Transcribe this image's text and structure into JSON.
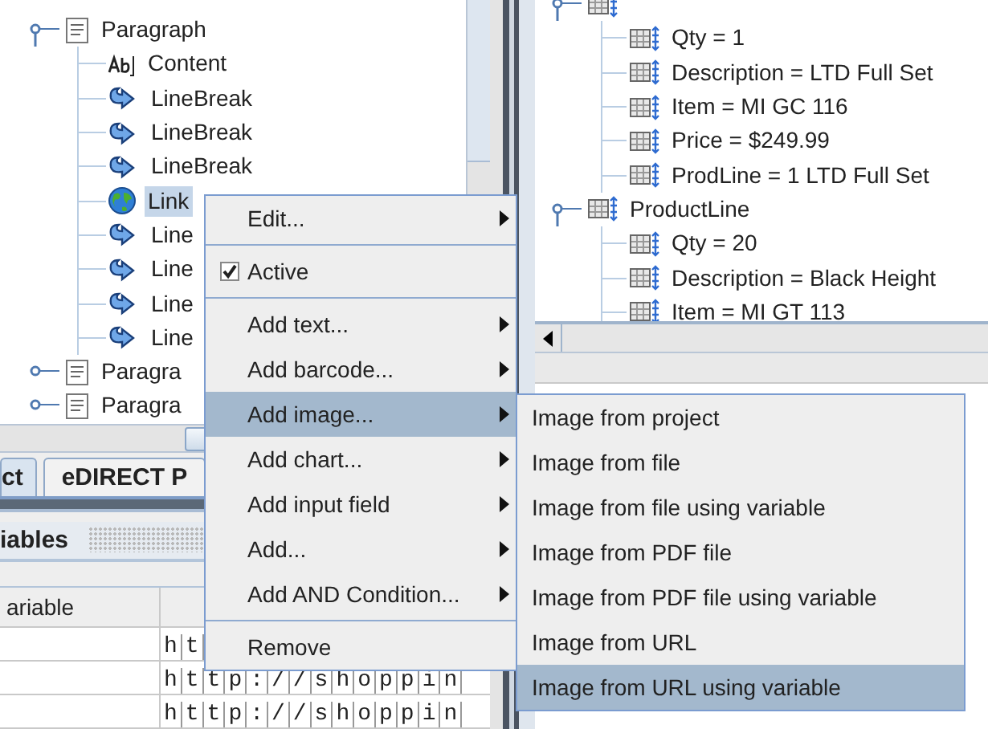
{
  "left_tree": {
    "items": [
      {
        "label": "Paragraph",
        "kind": "paragraph",
        "expanded": true,
        "selected": false,
        "children": [
          {
            "label": "Content",
            "kind": "text",
            "selected": false
          },
          {
            "label": "LineBreak",
            "kind": "linebreak",
            "selected": false
          },
          {
            "label": "LineBreak",
            "kind": "linebreak",
            "selected": false
          },
          {
            "label": "LineBreak",
            "kind": "linebreak",
            "selected": false
          },
          {
            "label": "Link",
            "kind": "link",
            "selected": true
          },
          {
            "label": "Line",
            "kind": "linebreak",
            "selected": false
          },
          {
            "label": "Line",
            "kind": "linebreak",
            "selected": false
          },
          {
            "label": "Line",
            "kind": "linebreak",
            "selected": false
          },
          {
            "label": "Line",
            "kind": "linebreak",
            "selected": false
          }
        ]
      },
      {
        "label": "Paragra",
        "kind": "paragraph",
        "expanded": false,
        "selected": false
      },
      {
        "label": "Paragra",
        "kind": "paragraph",
        "expanded": false,
        "selected": false
      }
    ]
  },
  "tabs": [
    {
      "label": "ct",
      "selected": true
    },
    {
      "label": "eDIRECT P",
      "selected": false
    }
  ],
  "variables_panel": {
    "title": "iables",
    "table": {
      "columns": [
        "ariable"
      ],
      "rows": [
        {
          "column_1": "",
          "column_2": "ht"
        },
        {
          "column_1": "",
          "column_2": "http://shoppin"
        },
        {
          "column_1": "",
          "column_2": "http://shoppin"
        }
      ]
    }
  },
  "right_tree": {
    "items": [
      {
        "expanded": true,
        "children": [
          {
            "label": "Qty = 1"
          },
          {
            "label": "Description = LTD Full Set"
          },
          {
            "label": "Item = MI GC 116"
          },
          {
            "label": "Price = $249.99"
          },
          {
            "label": "ProdLine = 1 LTD Full Set"
          }
        ]
      },
      {
        "label": "ProductLine",
        "expanded": true,
        "children": [
          {
            "label": "Qty = 20"
          },
          {
            "label": "Description = Black Height"
          },
          {
            "label": "Item = MI GT 113"
          }
        ]
      }
    ]
  },
  "context_menu": {
    "items": [
      {
        "kind": "item",
        "label": "Edit...",
        "submenu": true,
        "selected": false
      },
      {
        "kind": "separator"
      },
      {
        "kind": "check",
        "label": "Active",
        "checked": true,
        "selected": false
      },
      {
        "kind": "separator"
      },
      {
        "kind": "item",
        "label": "Add text...",
        "submenu": true,
        "selected": false
      },
      {
        "kind": "item",
        "label": "Add barcode...",
        "submenu": true,
        "selected": false
      },
      {
        "kind": "item",
        "label": "Add image...",
        "submenu": true,
        "selected": true
      },
      {
        "kind": "item",
        "label": "Add chart...",
        "submenu": true,
        "selected": false
      },
      {
        "kind": "item",
        "label": "Add input field",
        "submenu": true,
        "selected": false
      },
      {
        "kind": "item",
        "label": "Add...",
        "submenu": true,
        "selected": false
      },
      {
        "kind": "item",
        "label": "Add AND Condition...",
        "submenu": true,
        "selected": false
      },
      {
        "kind": "separator"
      },
      {
        "kind": "item",
        "label": "Remove",
        "submenu": false,
        "selected": false
      }
    ]
  },
  "submenu": {
    "items": [
      {
        "label": "Image from project",
        "selected": false
      },
      {
        "label": "Image from file",
        "selected": false
      },
      {
        "label": "Image from file using variable",
        "selected": false
      },
      {
        "label": "Image from PDF file",
        "selected": false
      },
      {
        "label": "Image from PDF file using variable",
        "selected": false
      },
      {
        "label": "Image from URL",
        "selected": false
      },
      {
        "label": "Image from URL using variable",
        "selected": true
      }
    ]
  }
}
